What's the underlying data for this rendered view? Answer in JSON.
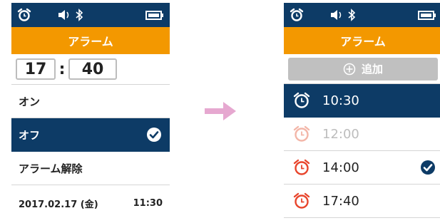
{
  "left_screen": {
    "title": "アラーム",
    "time": {
      "hour": "17",
      "separator": ":",
      "minute": "40"
    },
    "menu": [
      {
        "label": "オン",
        "selected": false
      },
      {
        "label": "オフ",
        "selected": true
      },
      {
        "label": "アラーム解除",
        "selected": false
      }
    ],
    "footer": {
      "date": "2017.02.17 (金)",
      "time": "11:30"
    }
  },
  "right_screen": {
    "title": "アラーム",
    "add_label": "追加",
    "alarms": [
      {
        "time": "10:30",
        "state": "selected"
      },
      {
        "time": "12:00",
        "state": "disabled"
      },
      {
        "time": "14:00",
        "state": "checked"
      },
      {
        "time": "17:40",
        "state": "normal"
      }
    ]
  },
  "status_icons": [
    "alarm-icon",
    "speaker-icon",
    "bluetooth-icon",
    "battery-icon"
  ],
  "colors": {
    "navy": "#0d3b66",
    "orange": "#f39800",
    "alarm_red": "#e8452c",
    "gray_button": "#c0c0c0",
    "arrow_pink": "#e6a8d0"
  }
}
